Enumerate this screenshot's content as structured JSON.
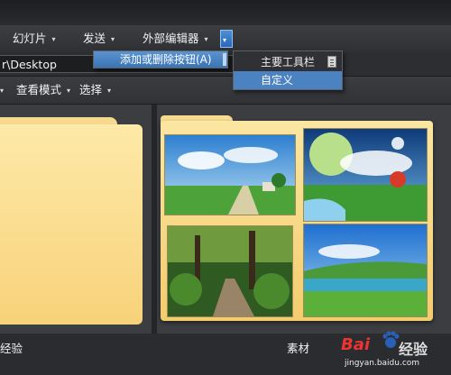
{
  "menubar": {
    "items": [
      {
        "label": "幻灯片"
      },
      {
        "label": "发送"
      },
      {
        "label": "外部编辑器"
      }
    ]
  },
  "submenu": {
    "add_remove_label": "添加或删除按钮(A)",
    "main_toolbar_label": "主要工具栏",
    "customize_label": "自定义"
  },
  "pathbar": {
    "path": "r\\Desktop"
  },
  "toolbar": {
    "view_mode_label": "查看模式",
    "select_label": "选择"
  },
  "panes": {
    "left_caption": "经验",
    "right_caption": "素材"
  },
  "watermark": {
    "brand": "Bai",
    "product": "经验",
    "url": "jingyan.baidu.com"
  },
  "icons": {
    "caret": "▾"
  },
  "colors": {
    "menu_highlight": "#3b74b4",
    "folder": "#f8d27a"
  }
}
